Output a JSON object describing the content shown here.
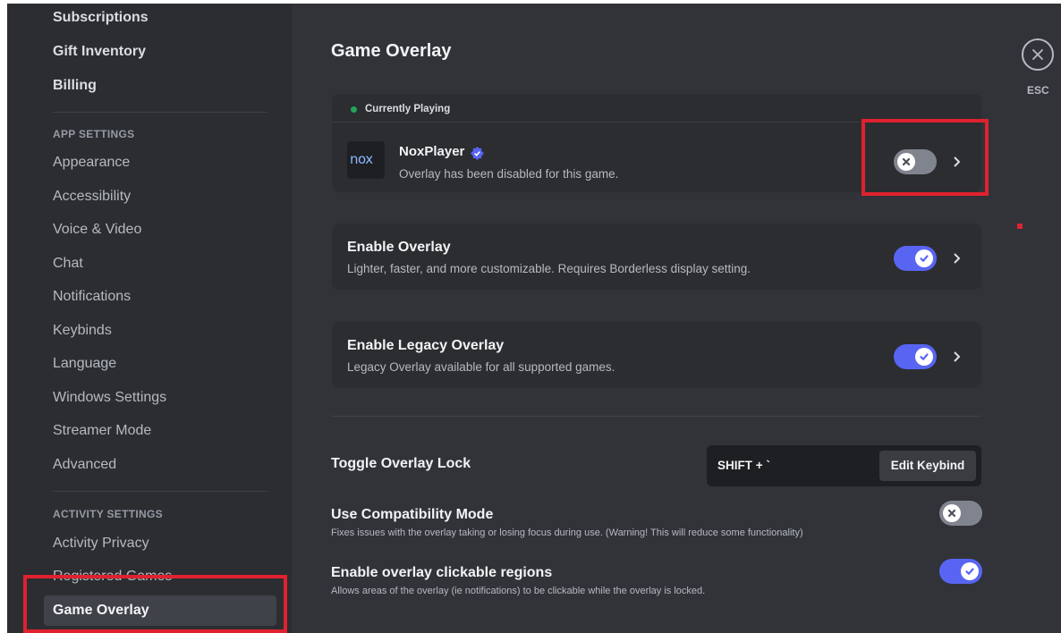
{
  "sidebar": {
    "top_items": [
      "Subscriptions",
      "Gift Inventory",
      "Billing"
    ],
    "app_settings_header": "APP SETTINGS",
    "app_items": [
      "Appearance",
      "Accessibility",
      "Voice & Video",
      "Chat",
      "Notifications",
      "Keybinds",
      "Language",
      "Windows Settings",
      "Streamer Mode",
      "Advanced"
    ],
    "activity_settings_header": "ACTIVITY SETTINGS",
    "activity_items": [
      "Activity Privacy",
      "Registered Games",
      "Game Overlay"
    ],
    "active_item": "Game Overlay"
  },
  "main": {
    "title": "Game Overlay",
    "currently_playing": {
      "label": "Currently Playing",
      "game_name": "NoxPlayer",
      "logo_text": "nox",
      "status": "Overlay has been disabled for this game.",
      "toggle": false
    },
    "enable_overlay": {
      "title": "Enable Overlay",
      "description": "Lighter, faster, and more customizable. Requires Borderless display setting.",
      "toggle": true
    },
    "legacy_overlay": {
      "title": "Enable Legacy Overlay",
      "description": "Legacy Overlay available for all supported games.",
      "toggle": true
    },
    "overlay_lock": {
      "title": "Toggle Overlay Lock",
      "keybind": "SHIFT + `",
      "edit_label": "Edit Keybind"
    },
    "compatibility": {
      "title": "Use Compatibility Mode",
      "description": "Fixes issues with the overlay taking or losing focus during use. (Warning! This will reduce some functionality)",
      "toggle": false
    },
    "clickable_regions": {
      "title": "Enable overlay clickable regions",
      "description": "Allows areas of the overlay (ie notifications) to be clickable while the overlay is locked.",
      "toggle": true
    }
  },
  "close": {
    "label": "ESC"
  },
  "icons": {
    "close": "close-icon",
    "chevron": "chevron-right-icon",
    "check": "check-icon",
    "x": "x-icon",
    "verified": "verified-badge-icon",
    "status_dot": "green-dot-icon"
  },
  "colors": {
    "accent": "#5865f2",
    "online": "#23a55a",
    "annotation": "#e0212e"
  }
}
